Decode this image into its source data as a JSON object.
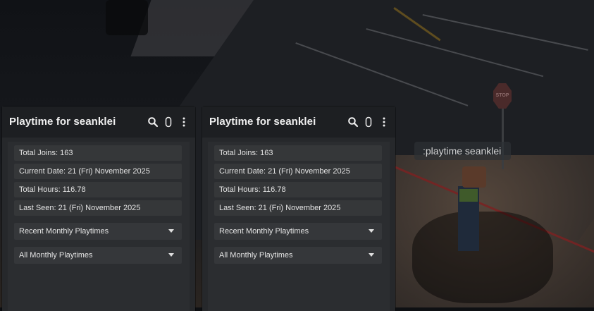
{
  "chat": {
    "message": ":playtime seanklei"
  },
  "panels": [
    {
      "title": "Playtime for seanklei",
      "stats": {
        "total_joins": "Total Joins: 163",
        "current_date": "Current Date: 21 (Fri) November 2025",
        "total_hours": "Total Hours: 116.78",
        "last_seen": "Last Seen: 21 (Fri) November 2025"
      },
      "dropdowns": {
        "recent": "Recent Monthly Playtimes",
        "all": "All Monthly Playtimes"
      },
      "icons": [
        "search-icon",
        "toggle-icon",
        "more-vertical-icon"
      ]
    },
    {
      "title": "Playtime for seanklei",
      "stats": {
        "total_joins": "Total Joins: 163",
        "current_date": "Current Date: 21 (Fri) November 2025",
        "total_hours": "Total Hours: 116.78",
        "last_seen": "Last Seen: 21 (Fri) November 2025"
      },
      "dropdowns": {
        "recent": "Recent Monthly Playtimes",
        "all": "All Monthly Playtimes"
      },
      "icons": [
        "search-icon",
        "toggle-icon",
        "more-vertical-icon"
      ]
    }
  ],
  "scene": {
    "sign_text": "STOP"
  },
  "colors": {
    "panel_bg": "#26282b",
    "header_bg": "#1d1f22",
    "row_bg": "#353739",
    "text": "#e4e4e4"
  }
}
